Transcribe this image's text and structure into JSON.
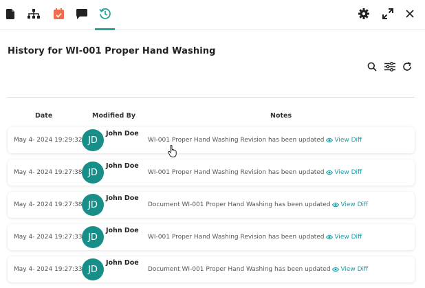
{
  "toolbar": {
    "left_icons": [
      "document-icon",
      "workflow-icon",
      "calendar-icon",
      "comment-icon",
      "history-icon"
    ],
    "right_icons": [
      "gear-icon",
      "expand-icon",
      "close-icon"
    ],
    "active_tab": "history-icon",
    "accent_color": "#26a69a",
    "calendar_color": "#ef6c4d"
  },
  "page": {
    "title": "History for WI-001 Proper Hand Washing"
  },
  "actions": [
    "search-icon",
    "filter-icon",
    "refresh-icon"
  ],
  "table": {
    "headers": {
      "date": "Date",
      "modified_by": "Modified By",
      "notes": "Notes"
    },
    "rows": [
      {
        "date": "May 4- 2024 19:29:32",
        "initials": "JD",
        "user": "John Doe",
        "note": "WI-001 Proper Hand Washing Revision has been updated",
        "diff": "View Diff"
      },
      {
        "date": "May 4- 2024 19:27:38",
        "initials": "JD",
        "user": "John Doe",
        "note": "WI-001 Proper Hand Washing Revision has been updated",
        "diff": "View Diff"
      },
      {
        "date": "May 4- 2024 19:27:38",
        "initials": "JD",
        "user": "John Doe",
        "note": "Document WI-001 Proper Hand Washing has been updated",
        "diff": "View Diff"
      },
      {
        "date": "May 4- 2024 19:27:33",
        "initials": "JD",
        "user": "John Doe",
        "note": "WI-001 Proper Hand Washing Revision has been updated",
        "diff": "View Diff"
      },
      {
        "date": "May 4- 2024 19:27:33",
        "initials": "JD",
        "user": "John Doe",
        "note": "Document WI-001 Proper Hand Washing has been updated",
        "diff": "View Diff"
      }
    ]
  }
}
